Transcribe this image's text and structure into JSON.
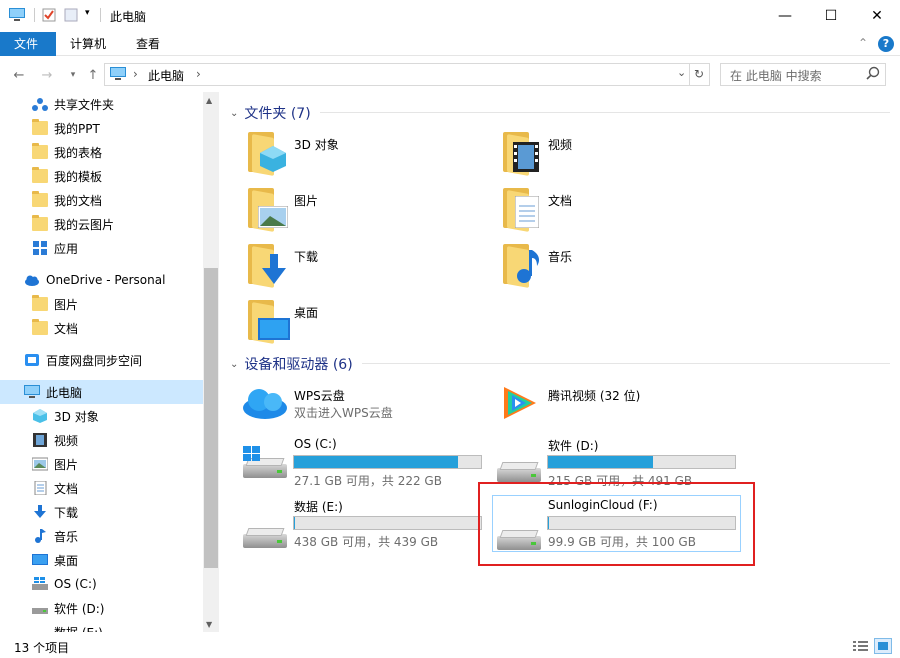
{
  "window": {
    "title": "此电脑",
    "minimize": "—",
    "maximize": "☐",
    "close": "✕"
  },
  "ribbon": {
    "tabs": [
      {
        "label": "文件"
      },
      {
        "label": "计算机"
      },
      {
        "label": "查看"
      }
    ],
    "collapse_icon": "chevron-up-icon",
    "help_icon": "help-icon"
  },
  "address": {
    "path": [
      {
        "label": "此电脑"
      }
    ],
    "search_placeholder": "在 此电脑 中搜索"
  },
  "nav": {
    "items": [
      {
        "label": "共享文件夹",
        "icon": "share-people-icon"
      },
      {
        "label": "我的PPT",
        "icon": "folder-icon"
      },
      {
        "label": "我的表格",
        "icon": "folder-icon"
      },
      {
        "label": "我的模板",
        "icon": "folder-icon"
      },
      {
        "label": "我的文档",
        "icon": "folder-icon"
      },
      {
        "label": "我的云图片",
        "icon": "folder-icon"
      },
      {
        "label": "应用",
        "icon": "apps-icon"
      },
      {
        "label": "OneDrive - Personal",
        "icon": "cloud-icon"
      },
      {
        "label": "图片",
        "icon": "folder-icon"
      },
      {
        "label": "文档",
        "icon": "folder-icon"
      },
      {
        "label": "百度网盘同步空间",
        "icon": "baidu-icon"
      },
      {
        "label": "此电脑",
        "icon": "computer-icon"
      },
      {
        "label": "3D 对象",
        "icon": "3d-objects-icon"
      },
      {
        "label": "视频",
        "icon": "video-icon"
      },
      {
        "label": "图片",
        "icon": "pictures-icon"
      },
      {
        "label": "文档",
        "icon": "documents-icon"
      },
      {
        "label": "下载",
        "icon": "download-icon"
      },
      {
        "label": "音乐",
        "icon": "music-icon"
      },
      {
        "label": "桌面",
        "icon": "desktop-icon"
      },
      {
        "label": "OS (C:)",
        "icon": "drive-icon"
      },
      {
        "label": "软件 (D:)",
        "icon": "drive-icon"
      },
      {
        "label": "数据 (E:)",
        "icon": "drive-icon"
      }
    ]
  },
  "folders": {
    "header": "文件夹 (7)",
    "items": [
      {
        "label": "3D 对象",
        "icon": "3d-objects-icon"
      },
      {
        "label": "视频",
        "icon": "video-icon"
      },
      {
        "label": "图片",
        "icon": "pictures-icon"
      },
      {
        "label": "文档",
        "icon": "documents-icon"
      },
      {
        "label": "下载",
        "icon": "download-icon"
      },
      {
        "label": "音乐",
        "icon": "music-icon"
      },
      {
        "label": "桌面",
        "icon": "desktop-icon"
      }
    ]
  },
  "devices": {
    "header": "设备和驱动器 (6)",
    "items": [
      {
        "name": "WPS云盘",
        "sub": "双击进入WPS云盘",
        "icon": "wps-cloud-icon"
      },
      {
        "name": "腾讯视频 (32 位)",
        "sub": "",
        "icon": "tencent-video-icon"
      },
      {
        "name": "OS (C:)",
        "sub": "27.1 GB 可用，共 222 GB",
        "used_fraction": 0.878
      },
      {
        "name": "软件 (D:)",
        "sub": "215 GB 可用，共 491 GB",
        "used_fraction": 0.562
      },
      {
        "name": "数据 (E:)",
        "sub": "438 GB 可用，共 439 GB",
        "used_fraction": 0.002
      },
      {
        "name": "SunloginCloud (F:)",
        "sub": "99.9 GB 可用，共 100 GB",
        "used_fraction": 0.001
      }
    ]
  },
  "status": {
    "count": "13 个项目"
  },
  "colors": {
    "accent": "#1979ca",
    "bar_fill": "#26a0da",
    "highlight": "#e02020"
  }
}
